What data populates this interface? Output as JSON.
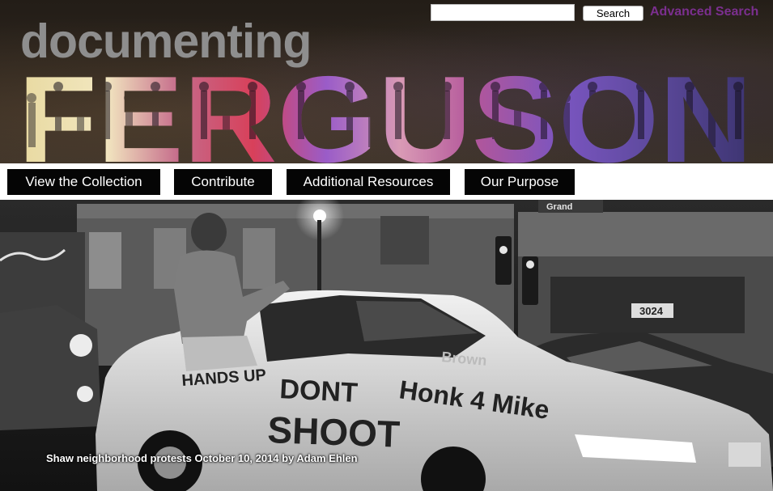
{
  "header": {
    "site_subtitle": "documenting",
    "site_title": "FERGUSON"
  },
  "search": {
    "input_value": "",
    "button_label": "Search",
    "advanced_label": "Advanced Search"
  },
  "nav": {
    "items": [
      {
        "label": "View the Collection"
      },
      {
        "label": "Contribute"
      },
      {
        "label": "Additional Resources"
      },
      {
        "label": "Our Purpose"
      }
    ]
  },
  "hero": {
    "caption": "Shaw neighborhood protests October 10, 2014 by Adam Ehlen",
    "car_text": {
      "hands_up": "HANDS UP",
      "dont": "DONT",
      "shoot": "SHOOT",
      "honk": "Honk 4 Mike",
      "brown": "Brown",
      "street_sign": "Grand",
      "address": "3024"
    }
  },
  "colors": {
    "accent": "#7b2f8f",
    "nav_bg": "#050505",
    "banner_bg": "#2a231c",
    "subtitle_gray": "#8e8e8e"
  }
}
